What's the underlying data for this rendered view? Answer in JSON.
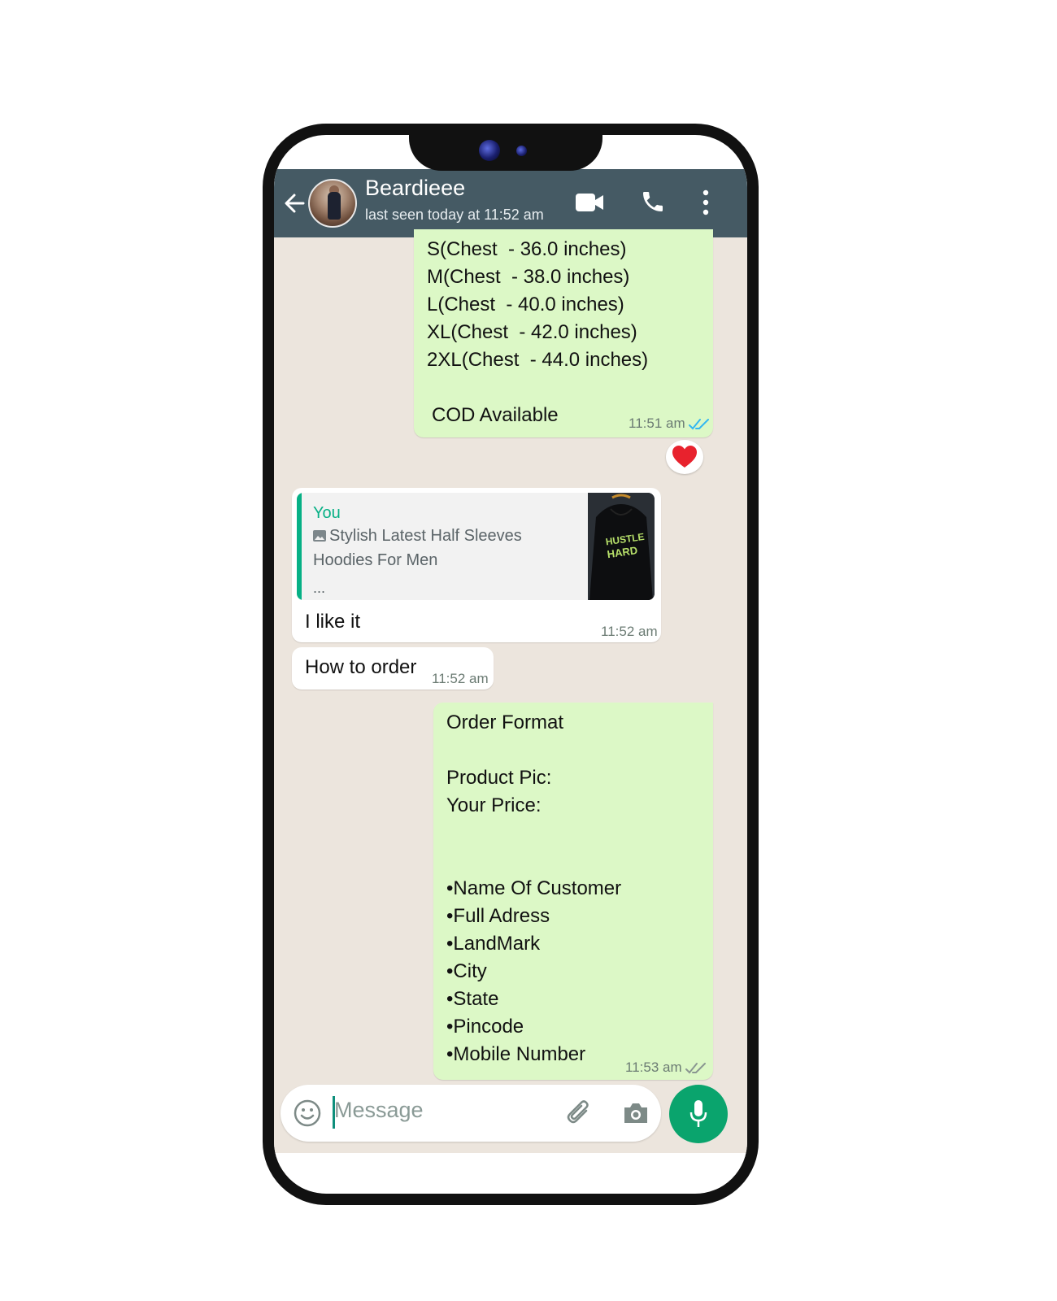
{
  "header": {
    "contact_name": "Beardieee",
    "status": "last seen today at 11:52 am"
  },
  "messages": {
    "sizes": {
      "lines": [
        "S(Chest  - 36.0 inches)",
        "M(Chest  - 38.0 inches)",
        "L(Chest  - 40.0 inches)",
        "XL(Chest  - 42.0 inches)",
        "2XL(Chest  - 44.0 inches)",
        "",
        "COD Available"
      ],
      "time": "11:51 am",
      "reaction": "❤️"
    },
    "reply": {
      "quote_author": "You",
      "quote_text": "Stylish Latest Half Sleeves Hoodies For Men",
      "quote_ellipsis": "...",
      "thumbnail_text": "HUSTLE HARD",
      "text": "I like it",
      "time": "11:52 am"
    },
    "how_to_order": {
      "text": "How to order",
      "time": "11:52 am"
    },
    "order_format": {
      "lines": [
        "Order Format",
        "",
        "Product Pic:",
        "Your Price:",
        "",
        "",
        "•Name Of Customer",
        "•Full Adress",
        "•LandMark",
        "•City",
        "•State",
        "•Pincode",
        "•Mobile Number"
      ],
      "time": "11:53 am"
    }
  },
  "composer": {
    "placeholder": "Message"
  },
  "colors": {
    "header_bg": "#455a64",
    "outgoing_bubble": "#dcf8c6",
    "chat_bg": "#ece5dd",
    "accent": "#0aa46d",
    "read_ticks": "#34b7f1"
  }
}
